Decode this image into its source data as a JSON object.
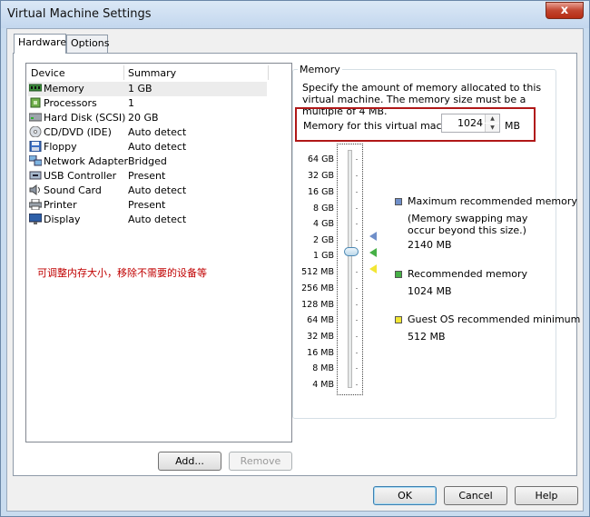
{
  "window": {
    "title": "Virtual Machine Settings",
    "close_glyph": "x"
  },
  "tabs": [
    {
      "label": "Hardware",
      "active": true
    },
    {
      "label": "Options",
      "active": false
    }
  ],
  "device_list": {
    "headers": {
      "device": "Device",
      "summary": "Summary"
    },
    "rows": [
      {
        "name": "Memory",
        "summary": "1 GB",
        "icon": "memory-icon",
        "selected": true
      },
      {
        "name": "Processors",
        "summary": "1",
        "icon": "processor-icon"
      },
      {
        "name": "Hard Disk (SCSI)",
        "summary": "20 GB",
        "icon": "hard-disk-icon"
      },
      {
        "name": "CD/DVD (IDE)",
        "summary": "Auto detect",
        "icon": "cd-dvd-icon"
      },
      {
        "name": "Floppy",
        "summary": "Auto detect",
        "icon": "floppy-icon"
      },
      {
        "name": "Network Adapter",
        "summary": "Bridged",
        "icon": "network-adapter-icon"
      },
      {
        "name": "USB Controller",
        "summary": "Present",
        "icon": "usb-icon"
      },
      {
        "name": "Sound Card",
        "summary": "Auto detect",
        "icon": "sound-card-icon"
      },
      {
        "name": "Printer",
        "summary": "Present",
        "icon": "printer-icon"
      },
      {
        "name": "Display",
        "summary": "Auto detect",
        "icon": "display-icon"
      }
    ]
  },
  "annotation_note": "可调整内存大小，移除不需要的设备等",
  "list_buttons": {
    "add": "Add...",
    "remove": "Remove"
  },
  "memory": {
    "group_title": "Memory",
    "description": "Specify the amount of memory allocated to this virtual machine. The memory size must be a multiple of 4 MB.",
    "field_label": "Memory for this virtual machine:",
    "value": "1024",
    "unit": "MB",
    "scale": [
      "64 GB",
      "32 GB",
      "16 GB",
      "8 GB",
      "4 GB",
      "2 GB",
      "1 GB",
      "512 MB",
      "256 MB",
      "128 MB",
      "64 MB",
      "32 MB",
      "16 MB",
      "8 MB",
      "4 MB"
    ],
    "legend": [
      {
        "label": "Maximum recommended memory",
        "note": "(Memory swapping may occur beyond this size.)",
        "value": "2140 MB",
        "color": "#6f8fc9"
      },
      {
        "label": "Recommended memory",
        "value": "1024 MB",
        "color": "#46b046"
      },
      {
        "label": "Guest OS recommended minimum",
        "value": "512 MB",
        "color": "#f2e634"
      }
    ]
  },
  "footer_buttons": {
    "ok": "OK",
    "cancel": "Cancel",
    "help": "Help"
  },
  "colors": {
    "highlight": "#b01818",
    "annotation": "#c00000"
  }
}
